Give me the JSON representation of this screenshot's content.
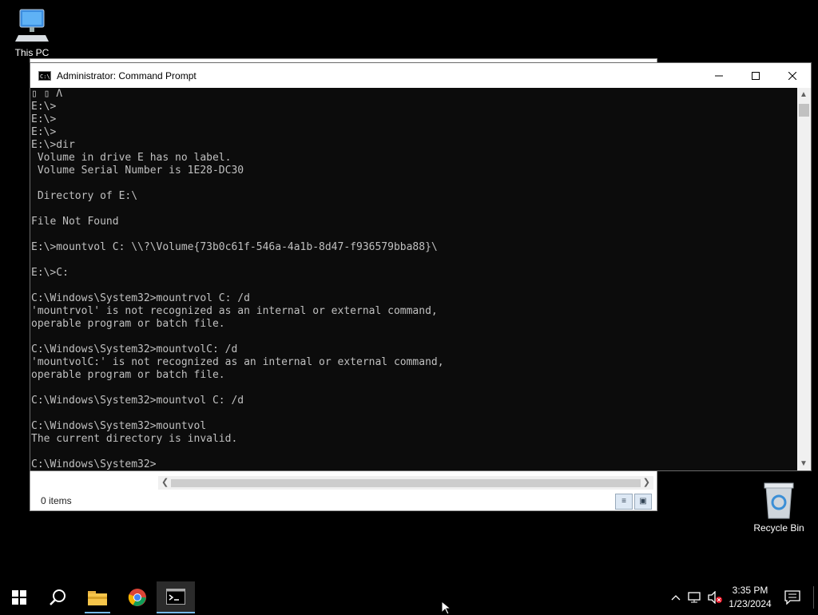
{
  "desktop": {
    "this_pc_label": "This PC",
    "recycle_bin_label": "Recycle Bin"
  },
  "explorer": {
    "status_text": "0 items"
  },
  "cmd": {
    "title": "Administrator: Command Prompt",
    "app_icon_text": "C:\\",
    "console_lines": [
      "▯ ▯ Λ",
      "E:\\>",
      "E:\\>",
      "E:\\>",
      "E:\\>dir",
      " Volume in drive E has no label.",
      " Volume Serial Number is 1E28-DC30",
      "",
      " Directory of E:\\",
      "",
      "File Not Found",
      "",
      "E:\\>mountvol C: \\\\?\\Volume{73b0c61f-546a-4a1b-8d47-f936579bba88}\\",
      "",
      "E:\\>C:",
      "",
      "C:\\Windows\\System32>mountrvol C: /d",
      "'mountrvol' is not recognized as an internal or external command,",
      "operable program or batch file.",
      "",
      "C:\\Windows\\System32>mountvolC: /d",
      "'mountvolC:' is not recognized as an internal or external command,",
      "operable program or batch file.",
      "",
      "C:\\Windows\\System32>mountvol C: /d",
      "",
      "C:\\Windows\\System32>mountvol",
      "The current directory is invalid.",
      "",
      "C:\\Windows\\System32>"
    ]
  },
  "taskbar": {
    "items": [
      "start-icon",
      "search-icon",
      "file-explorer-icon",
      "chrome-icon",
      "command-prompt-icon"
    ],
    "clock_time": "3:35 PM",
    "clock_date": "1/23/2024",
    "accent_color": "#76b9ed"
  }
}
